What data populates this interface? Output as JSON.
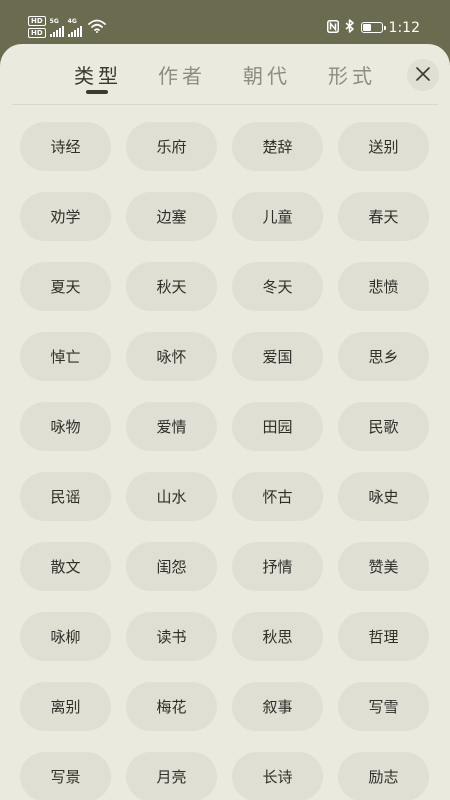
{
  "status_bar": {
    "hd1": "HD",
    "hd2": "HD",
    "net1": "5G",
    "net2": "4G",
    "time": "1:12",
    "battery_level": 0.45
  },
  "tabs": [
    {
      "label": "类型",
      "active": true
    },
    {
      "label": "作者",
      "active": false
    },
    {
      "label": "朝代",
      "active": false
    },
    {
      "label": "形式",
      "active": false
    }
  ],
  "chips": [
    "诗经",
    "乐府",
    "楚辞",
    "送别",
    "劝学",
    "边塞",
    "儿童",
    "春天",
    "夏天",
    "秋天",
    "冬天",
    "悲愤",
    "悼亡",
    "咏怀",
    "爱国",
    "思乡",
    "咏物",
    "爱情",
    "田园",
    "民歌",
    "民谣",
    "山水",
    "怀古",
    "咏史",
    "散文",
    "闺怨",
    "抒情",
    "赞美",
    "咏柳",
    "读书",
    "秋思",
    "哲理",
    "离别",
    "梅花",
    "叙事",
    "写雪",
    "写景",
    "月亮",
    "长诗",
    "励志"
  ],
  "icons": {
    "close": "close-icon",
    "wifi": "wifi-icon",
    "nfc": "nfc-icon",
    "bluetooth": "bluetooth-icon",
    "battery": "battery-icon"
  },
  "colors": {
    "status_bg": "#6b6b4f",
    "sheet_bg": "#ebeadf",
    "chip_bg": "#e0dfd4",
    "text_dark": "#2f2f2a",
    "tab_inactive": "#8d8d86"
  }
}
